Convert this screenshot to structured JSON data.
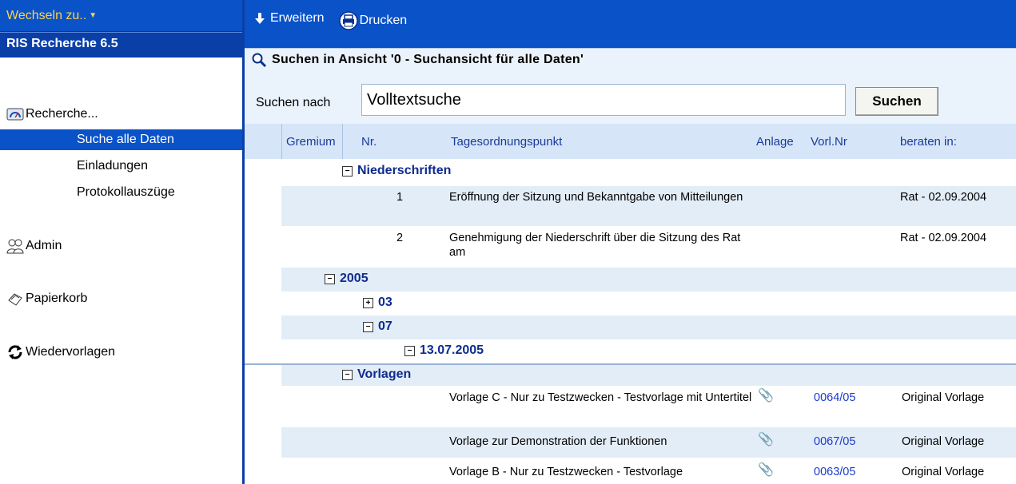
{
  "sidebar": {
    "switch_label": "Wechseln zu..",
    "app_title": "RIS Recherche 6.5",
    "sections": [
      {
        "label": "Recherche...",
        "icon": "search-gauge-icon"
      },
      {
        "label": "Admin",
        "icon": "users-icon"
      },
      {
        "label": "Papierkorb",
        "icon": "recycle-bin-icon"
      },
      {
        "label": "Wiedervorlagen",
        "icon": "refresh-icon"
      }
    ],
    "items": [
      {
        "label": "Suche alle Daten",
        "selected": true
      },
      {
        "label": "Einladungen"
      },
      {
        "label": "Protokollauszüge"
      }
    ]
  },
  "toolbar": {
    "expand_label": "Erweitern",
    "print_label": "Drucken"
  },
  "search": {
    "title": "Suchen in Ansicht '0 - Suchansicht für alle Daten'",
    "label": "Suchen nach",
    "value": "Volltextsuche",
    "button_label": "Suchen"
  },
  "columns": [
    "Gremium",
    "Nr.",
    "Tagesordnungspunkt",
    "Anlage",
    "Vorl.Nr",
    "beraten in:"
  ],
  "groups": {
    "niederschriften": "Niederschriften",
    "year": "2005",
    "month_03": "03",
    "month_07": "07",
    "date": "13.07.2005",
    "vorlagen": "Vorlagen"
  },
  "rows": [
    {
      "nr": "1",
      "top": "Eröffnung der Sitzung und Bekanntgabe von Mitteilungen",
      "beraten": "Rat - 02.09.2004"
    },
    {
      "nr": "2",
      "top": "Genehmigung der Niederschrift über die Sitzung des Rat am",
      "beraten": "Rat - 02.09.2004"
    }
  ],
  "vorlagen_rows": [
    {
      "top": "Vorlage C -  Nur zu Testzwecken -   Testvorlage mit Untertitel",
      "vorl": "0064/05",
      "beraten": "Original Vorlage",
      "attachment": true
    },
    {
      "top": "Vorlage zur Demonstration der Funktionen",
      "vorl": "0067/05",
      "beraten": "Original Vorlage",
      "attachment": true
    },
    {
      "top": "Vorlage B  - Nur zu Testzwecken -  Testvorlage",
      "vorl": "0063/05",
      "beraten": "Original Vorlage",
      "attachment": true
    }
  ],
  "colors": {
    "accent": "#0a52c8",
    "header_bg": "#d6e6f8",
    "alt_row": "#e3edf8",
    "group_text": "#0f2b8f",
    "link": "#1a3ad1"
  }
}
